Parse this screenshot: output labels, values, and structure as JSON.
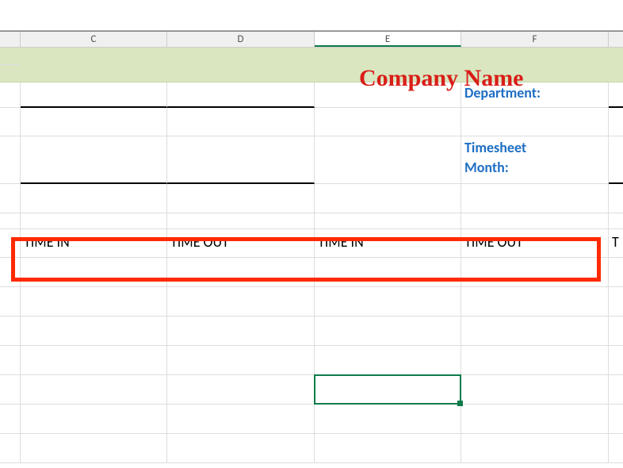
{
  "columns": {
    "c": "C",
    "d": "D",
    "e": "E",
    "f": "F"
  },
  "active_column": "E",
  "title": "Company Name",
  "labels": {
    "department": "Department:",
    "timesheet_month_1": "Timesheet",
    "timesheet_month_2": "Month:"
  },
  "headers": {
    "col_c": "TIME IN",
    "col_d": "TIME OUT",
    "col_e": "TIME IN",
    "col_f": "TIME OUT",
    "col_g_partial": "T"
  },
  "column_widths": {
    "stub": 26,
    "c": 185,
    "d": 186,
    "e": 185,
    "f": 186,
    "g_partial": 18
  }
}
